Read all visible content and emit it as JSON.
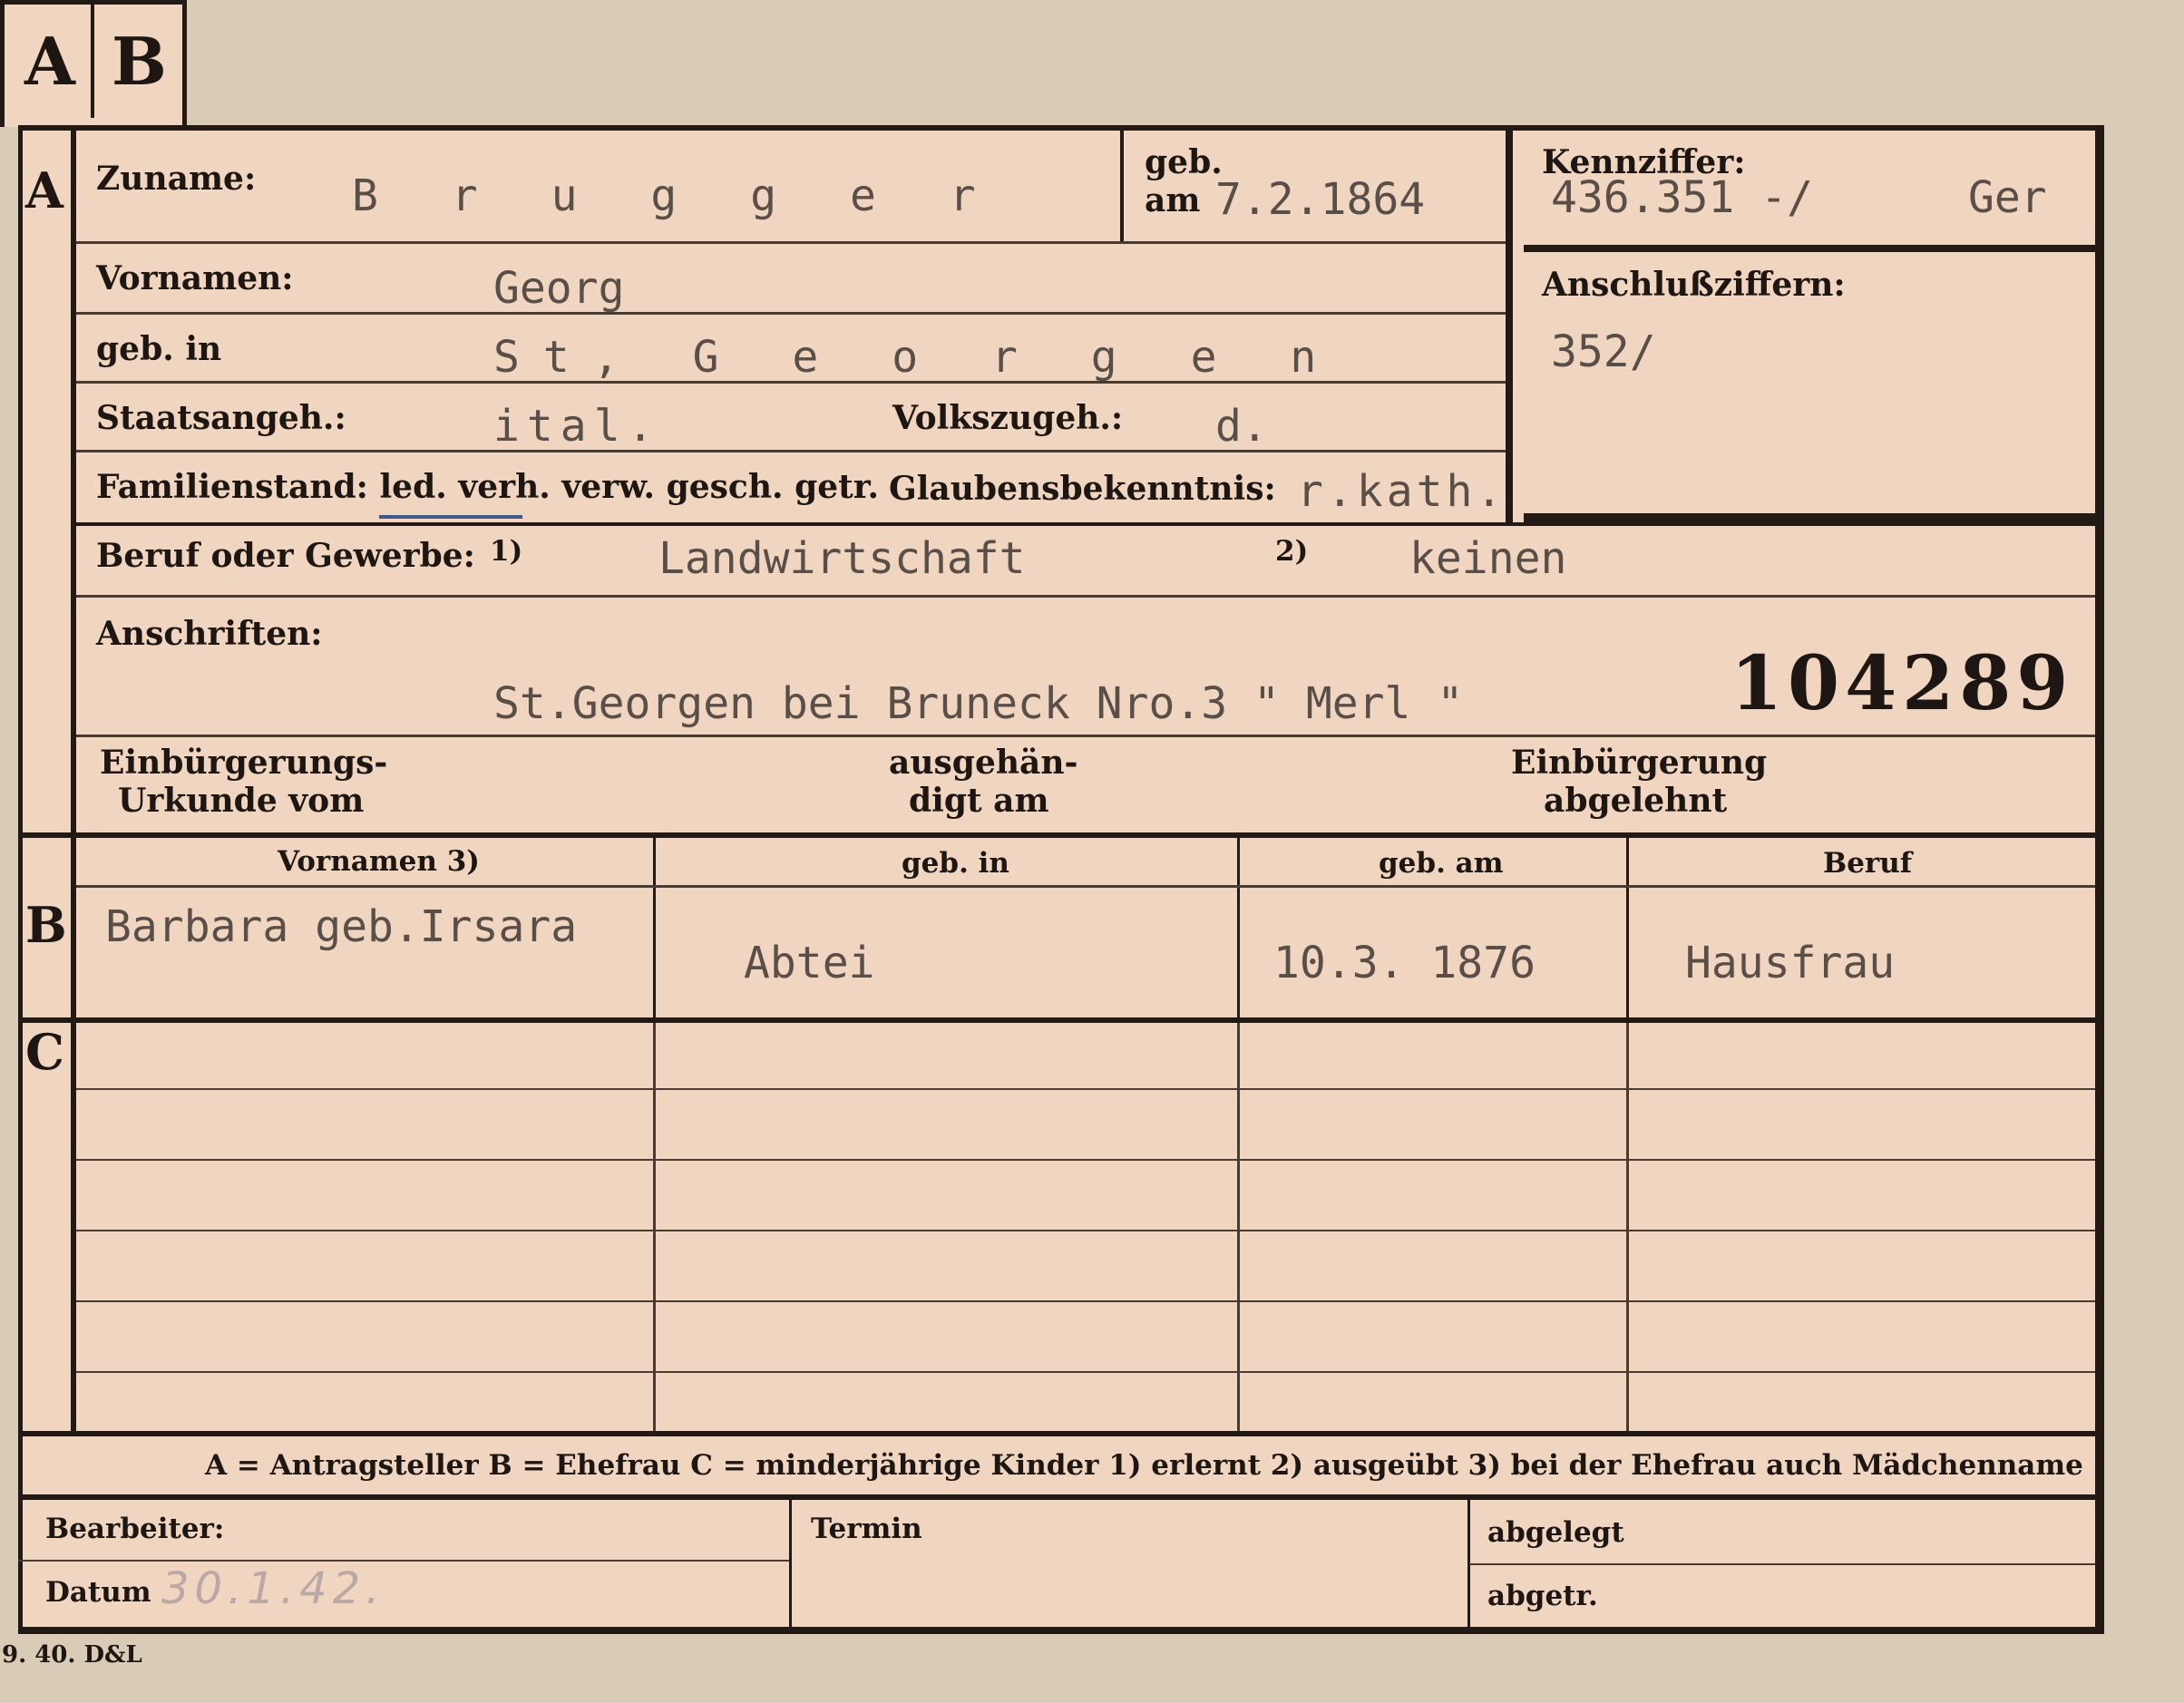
{
  "tabs": {
    "a": "A",
    "b": "B"
  },
  "sections": {
    "a": "A",
    "b": "B",
    "c": "C"
  },
  "applicant": {
    "surname_label": "Zuname:",
    "surname": "B r u g g e r",
    "born_label_1": "geb.",
    "born_label_2": "am",
    "born_date": "7.2.1864",
    "firstname_label": "Vornamen:",
    "firstname": "Georg",
    "birthplace_label": "geb. in",
    "birthplace": "St, G e o r g e n",
    "citizenship_label": "Staatsangeh.:",
    "citizenship": "ital.",
    "ethnicity_label": "Volkszugeh.:",
    "ethnicity": "d.",
    "family_label": "Familienstand: led. verh. verw. gesch. getr.",
    "religion_label": "Glaubensbekenntnis:",
    "religion": "r.kath.",
    "profession_label": "Beruf oder Gewerbe:",
    "note1": "1)",
    "profession_1": "Landwirtschaft",
    "note2": "2)",
    "profession_2": "keinen",
    "address_label": "Anschriften:",
    "address": "St.Georgen bei Bruneck Nro.3 \" Merl \"",
    "file_number": "104289",
    "naturalization_label_1": "Einbürgerungs-",
    "naturalization_label_2": "Urkunde vom",
    "handed_label_1": "ausgehän-",
    "handed_label_2": "digt am",
    "refused_label_1": "Einbürgerung",
    "refused_label_2": "abgelehnt"
  },
  "id_box": {
    "kennziffer_label": "Kennziffer:",
    "kennziffer": "436.351 -/",
    "kennziffer_suffix": "Ger",
    "anschluss_label": "Anschlußziffern:",
    "anschluss": "352/"
  },
  "spouse_table": {
    "headers": [
      "Vornamen 3)",
      "geb. in",
      "geb. am",
      "Beruf"
    ],
    "row": [
      "Barbara geb.Irsara",
      "Abtei",
      "10.3. 1876",
      "Hausfrau"
    ]
  },
  "legend": "A = Antragsteller   B = Ehefrau   C = minderjährige Kinder   1) erlernt   2) ausgeübt   3) bei der Ehefrau auch Mädchenname",
  "footer": {
    "bearbeiter_label": "Bearbeiter:",
    "datum_label": "Datum",
    "datum_value": "30.1.42.",
    "termin_label": "Termin",
    "abgelegt_label": "abgelegt",
    "abgetr_label": "abgetr."
  },
  "printer_mark": "9. 40. D&L"
}
